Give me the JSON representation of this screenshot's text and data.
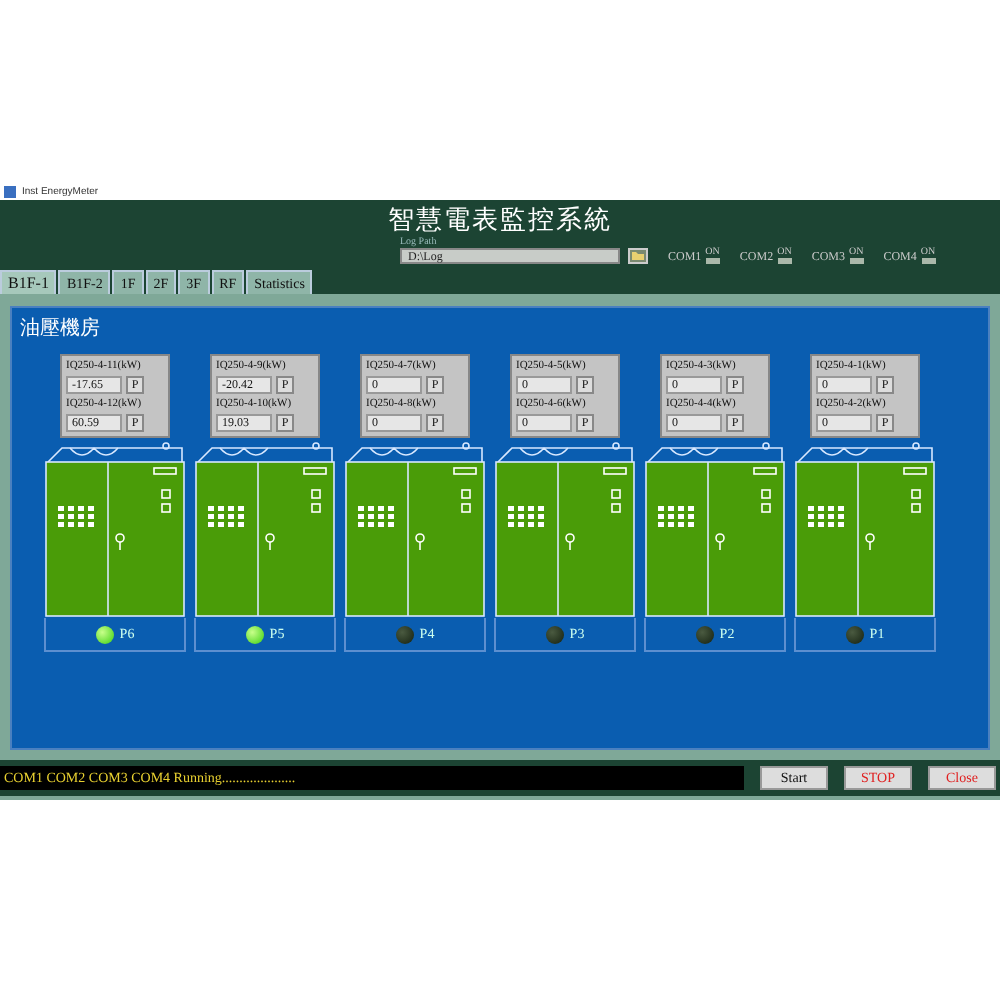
{
  "window": {
    "title": "Inst EnergyMeter"
  },
  "header": {
    "title": "智慧電表監控系統",
    "log_path": {
      "label": "Log Path",
      "value": "D:\\Log"
    },
    "com_ports": [
      {
        "label": "COM1",
        "state_label": "ON",
        "on": true
      },
      {
        "label": "COM2",
        "state_label": "ON",
        "on": true
      },
      {
        "label": "COM3",
        "state_label": "ON",
        "on": true
      },
      {
        "label": "COM4",
        "state_label": "ON",
        "on": true
      }
    ]
  },
  "tabs": [
    {
      "label": "B1F-1",
      "selected": true
    },
    {
      "label": "B1F-2",
      "selected": false
    },
    {
      "label": "1F",
      "selected": false
    },
    {
      "label": "2F",
      "selected": false
    },
    {
      "label": "3F",
      "selected": false
    },
    {
      "label": "RF",
      "selected": false
    },
    {
      "label": "Statistics",
      "selected": false
    }
  ],
  "section": {
    "title": "油壓機房"
  },
  "units": [
    {
      "readings": [
        {
          "label": "IQ250-4-11(kW)",
          "value": "-17.65",
          "button": "P"
        },
        {
          "label": "IQ250-4-12(kW)",
          "value": "60.59",
          "button": "P"
        }
      ],
      "lamp": "P6",
      "on": true
    },
    {
      "readings": [
        {
          "label": "IQ250-4-9(kW)",
          "value": "-20.42",
          "button": "P"
        },
        {
          "label": "IQ250-4-10(kW)",
          "value": "19.03",
          "button": "P"
        }
      ],
      "lamp": "P5",
      "on": true
    },
    {
      "readings": [
        {
          "label": "IQ250-4-7(kW)",
          "value": "0",
          "button": "P"
        },
        {
          "label": "IQ250-4-8(kW)",
          "value": "0",
          "button": "P"
        }
      ],
      "lamp": "P4",
      "on": false
    },
    {
      "readings": [
        {
          "label": "IQ250-4-5(kW)",
          "value": "0",
          "button": "P"
        },
        {
          "label": "IQ250-4-6(kW)",
          "value": "0",
          "button": "P"
        }
      ],
      "lamp": "P3",
      "on": false
    },
    {
      "readings": [
        {
          "label": "IQ250-4-3(kW)",
          "value": "0",
          "button": "P"
        },
        {
          "label": "IQ250-4-4(kW)",
          "value": "0",
          "button": "P"
        }
      ],
      "lamp": "P2",
      "on": false
    },
    {
      "readings": [
        {
          "label": "IQ250-4-1(kW)",
          "value": "0",
          "button": "P"
        },
        {
          "label": "IQ250-4-2(kW)",
          "value": "0",
          "button": "P"
        }
      ],
      "lamp": "P1",
      "on": false
    }
  ],
  "status_bar": {
    "message": "COM1 COM2 COM3 COM4 Running.....................",
    "buttons": [
      {
        "label": "Start",
        "kind": "normal"
      },
      {
        "label": "STOP",
        "kind": "danger"
      },
      {
        "label": "Close",
        "kind": "danger"
      }
    ]
  }
}
